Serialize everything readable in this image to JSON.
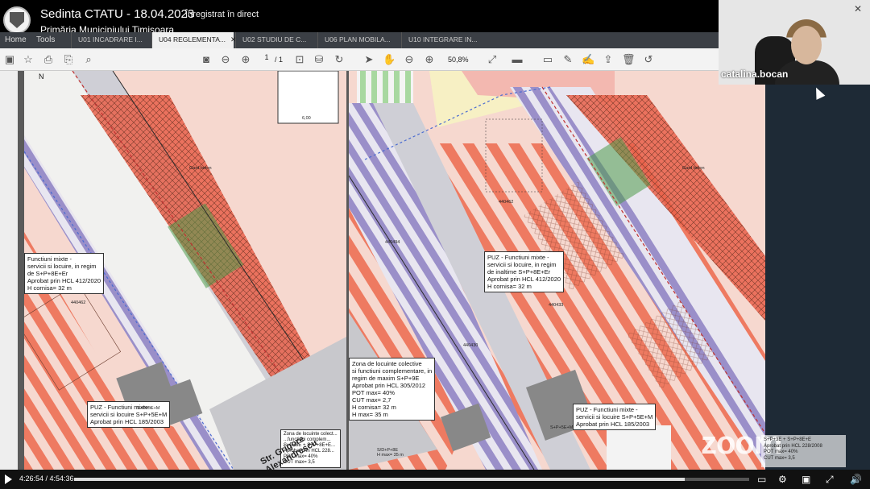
{
  "stream": {
    "title": "Sedinta CTATU - 18.04.2023",
    "live_label": "Înregistrat în direct",
    "channel": "Primăria Municipiului Timișoara"
  },
  "menu": {
    "home": "Home",
    "tools": "Tools"
  },
  "tabs": [
    {
      "label": "U01 INCADRARE I...",
      "active": false
    },
    {
      "label": "U04 REGLEMENTA...",
      "active": true
    },
    {
      "label": "U02 STUDIU DE C...",
      "active": false
    },
    {
      "label": "U06 PLAN MOBILA...",
      "active": false
    },
    {
      "label": "U10 INTEGRARE IN...",
      "active": false
    }
  ],
  "toolbar": {
    "page_number": "1",
    "page_total": "/ 1",
    "zoom": "50,8%",
    "icons": [
      "save-icon",
      "star-icon",
      "export-icon",
      "print-icon",
      "search-icon",
      "snapshot-icon",
      "prev-page-icon",
      "next-page-icon",
      "zoom-region-icon",
      "stamp-icon",
      "rotate-icon",
      "select-arrow-icon",
      "hand-icon",
      "zoom-out-icon",
      "zoom-in-icon",
      "fit-icon",
      "highlight-icon",
      "comment-icon",
      "pen-icon",
      "sign-icon",
      "share-icon",
      "trash-icon",
      "undo-icon"
    ]
  },
  "plan_left": {
    "label_puz_1": "Functiuni mixte -\nservicii si locuire, in regim\nde S+P+8E+Er\nAprobat prin HCL 412/2020\nH cornisa= 32 m",
    "label_puz_2": "PUZ - Functiuni mixte -\nservicii si locuire S+P+5E+M\nAprobat prin HCL 185/2003",
    "label_puz_3": "Zona de locuinte colect...\n...functiuni complem...\nS+P+3E + S+P+8E+E...\nAprobat prin HCL 228...\nPOT max= 40%\nCUT max= 3,5",
    "gard_beton": "Gard beton",
    "lot_code": "440462",
    "street": "Str. Grigore Alexandrescu",
    "house_code": "S+P+5E+M",
    "section_width": "6,00"
  },
  "plan_right": {
    "label_puz_1": "PUZ - Functiuni mixte -\nservicii si locuire, in regim\nde inaltime S+P+8E+Er\nAprobat prin HCL 412/2020\nH cornisa= 32 m",
    "label_zone": "Zona de locuinte colective\nsi functiuni complementare, in\nregim de maxim S+P+9E\nAprobat prin HCL 305/2012\nPOT max= 40%\nCUT max= 2,7\nH cornisa= 32 m\nH max= 35 m",
    "label_puz_2": "PUZ - Functiuni mixte -\nservicii si locuire S+P+5E+M\nAprobat prin HCL 185/2003",
    "gard_beton": "Gard beton",
    "lot_codes": [
      "440462",
      "440494",
      "440433",
      "440430"
    ],
    "house_code": "S+P+5E+M",
    "s_house_code": "S/D+P+8E\nH max= 35 m"
  },
  "participant": {
    "name": "catalina.bocan"
  },
  "watermark": {
    "brand": "zoom",
    "box_text": "S+P+3E + S+P+8E+E\nAprobat prin HCL 228/2008\nPOT max= 40%\nCUT max= 3,5"
  },
  "player": {
    "time": "4:26:54 / 4:54:36",
    "progress_fraction": 0.905
  },
  "colors": {
    "plan_pink": "#f6d8cf",
    "stripe_red": "#e9604a",
    "road_gray": "#c8c8cc",
    "accent_blue": "#2563c7"
  }
}
